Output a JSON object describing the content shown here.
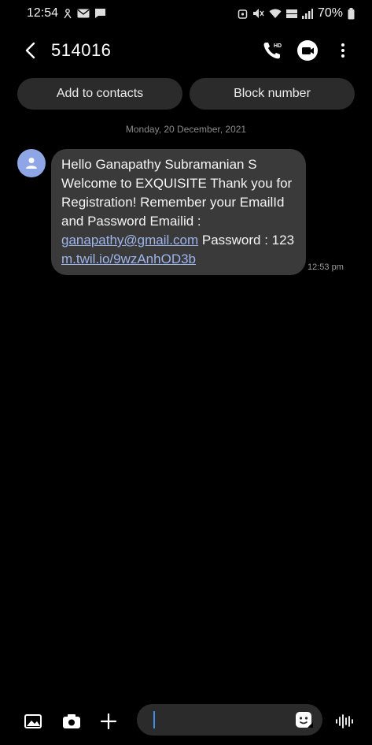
{
  "status_bar": {
    "time": "12:54",
    "battery": "70%"
  },
  "header": {
    "contact_number": "514016",
    "icons": [
      "back-arrow-icon",
      "hd-call-icon",
      "video-call-icon",
      "more-vert-icon"
    ]
  },
  "actions": {
    "add_to_contacts": "Add to contacts",
    "block_number": "Block number"
  },
  "conversation": {
    "date": "Monday, 20 December, 2021",
    "messages": [
      {
        "text_part1": "Hello Ganapathy Subramanian S Welcome to EXQUISITE Thank you for Registration! Remember your EmailId and Password Emailid : ",
        "email_link": "ganapathy@gmail.com",
        "text_part2": " Password : 123 ",
        "url_link": "m.twil.io/9wzAnhOD3b",
        "time": "12:53 pm"
      }
    ]
  },
  "composer": {
    "message_value": "",
    "icons": [
      "gallery-icon",
      "camera-icon",
      "plus-icon",
      "sticker-icon",
      "voice-icon"
    ]
  },
  "colors": {
    "background": "#000000",
    "bubble": "#3a3a3a",
    "pill": "#2b2b2b",
    "link": "#9db4ec",
    "avatar": "#8ea6e6",
    "caret": "#3b8de8"
  }
}
